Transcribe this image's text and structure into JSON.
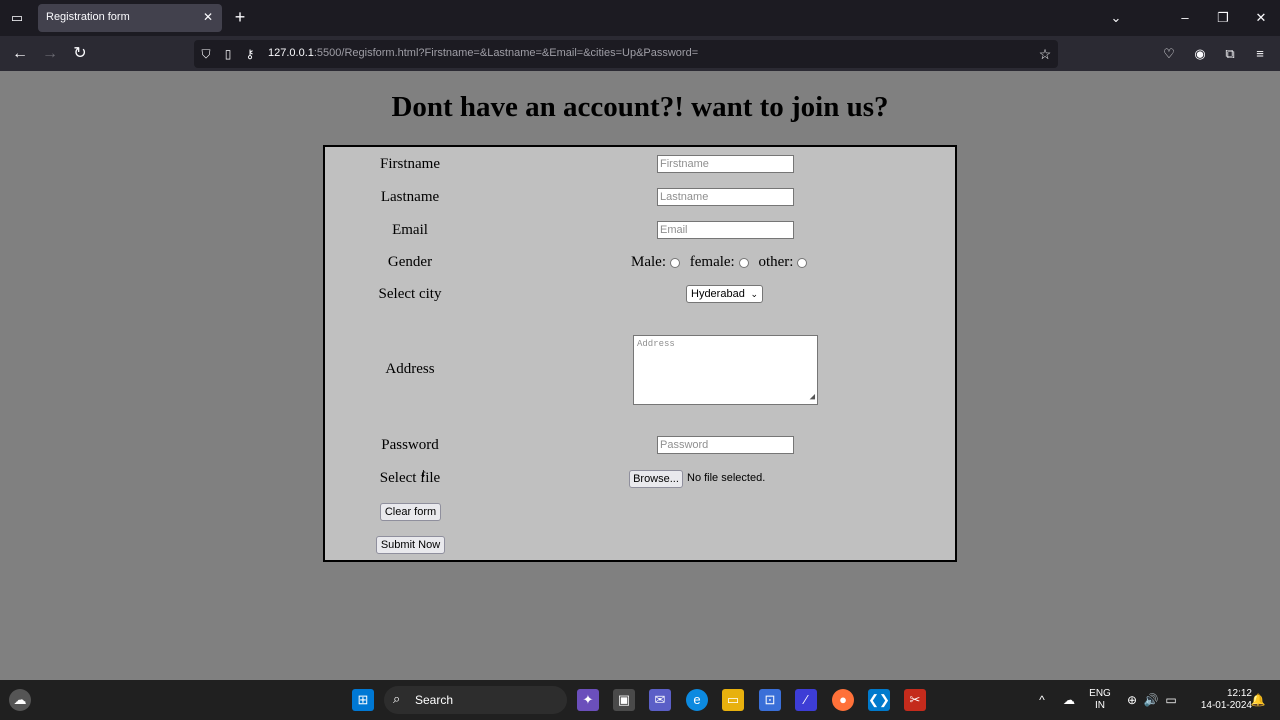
{
  "browser": {
    "tab_title": "Registration form",
    "url_host": "127.0.0.1",
    "url_rest": ":5500/Regisform.html?Firstname=&Lastname=&Email=&cities=Up&Password="
  },
  "page": {
    "heading": "Dont have an account?! want to join us?",
    "form": {
      "firstname_label": "Firstname",
      "firstname_placeholder": "Firstname",
      "lastname_label": "Lastname",
      "lastname_placeholder": "Lastname",
      "email_label": "Email",
      "email_placeholder": "Email",
      "gender_label": "Gender",
      "gender_options": [
        "Male:",
        "female:",
        "other:"
      ],
      "city_label": "Select city",
      "city_selected": "Hyderabad",
      "address_label": "Address",
      "address_placeholder": "Address",
      "password_label": "Password",
      "password_placeholder": "Password",
      "file_label": "Select file",
      "browse_label": "Browse...",
      "file_status": "No file selected.",
      "clear_label": "Clear form",
      "submit_label": "Submit Now"
    }
  },
  "taskbar": {
    "search_label": "Search",
    "lang_top": "ENG",
    "lang_bottom": "IN",
    "time": "12:12",
    "date": "14-01-2024"
  }
}
